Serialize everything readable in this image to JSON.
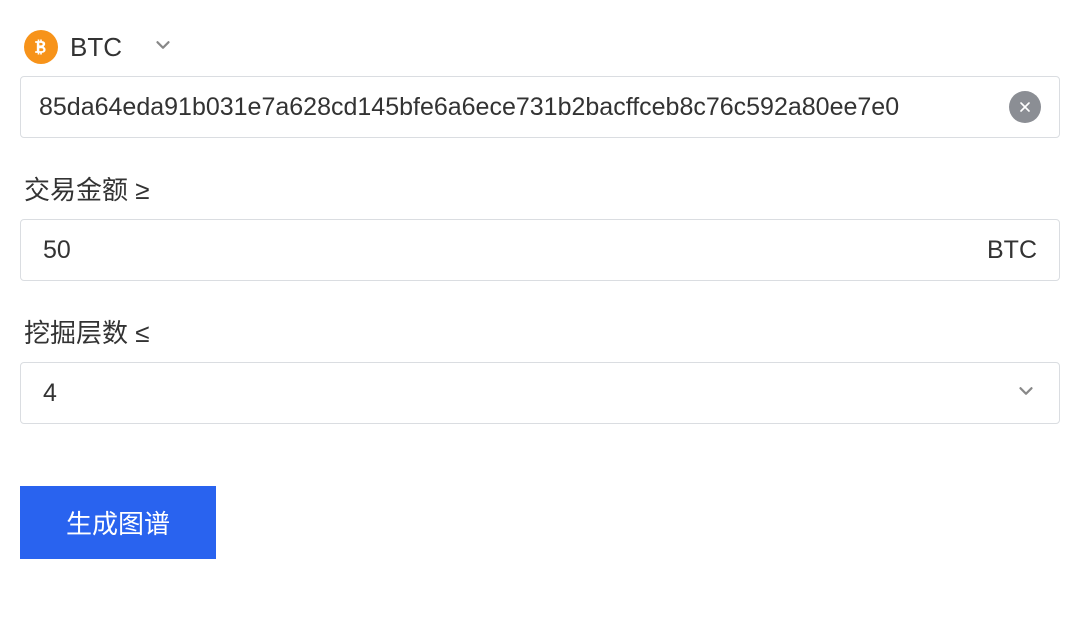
{
  "currency": {
    "code": "BTC",
    "icon_name": "bitcoin-icon"
  },
  "hash_input": {
    "value": "85da64eda91b031e7a628cd145bfe6a6ece731b2bacffceb8c76c592a80ee7e0"
  },
  "amount_field": {
    "label": "交易金额 ≥",
    "value": "50",
    "suffix": "BTC"
  },
  "depth_field": {
    "label": "挖掘层数 ≤",
    "value": "4"
  },
  "generate_button": {
    "label": "生成图谱"
  }
}
